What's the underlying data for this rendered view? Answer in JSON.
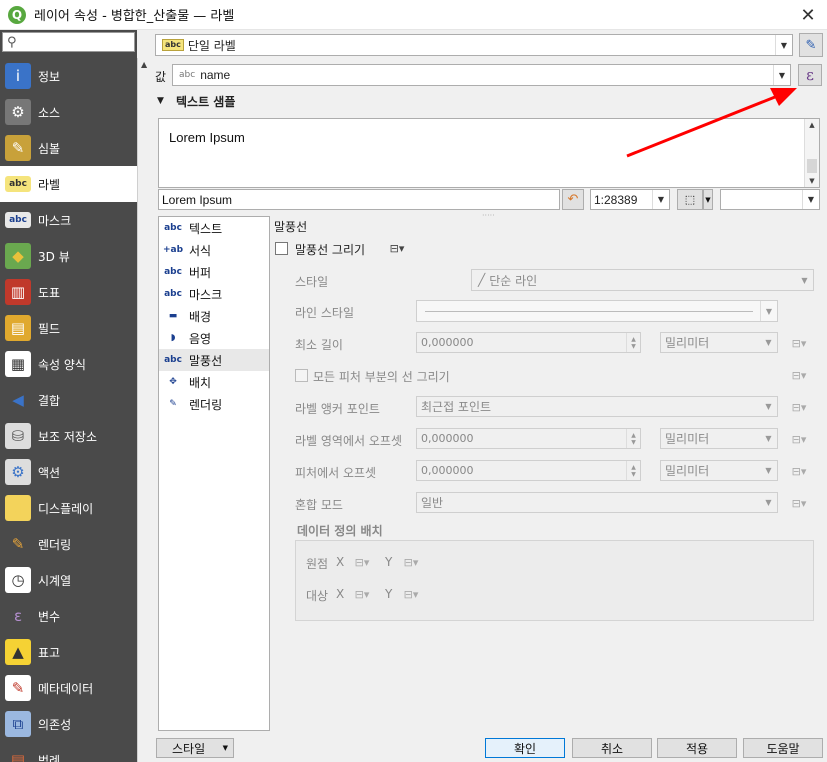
{
  "window": {
    "title": "레이어 속성 - 병합한_산출물 — 라벨",
    "close_glyph": "✕"
  },
  "sidebar": {
    "search_placeholder": "",
    "items": [
      {
        "label": "정보",
        "icon": "info-icon",
        "active": false
      },
      {
        "label": "소스",
        "icon": "source-wrench-icon",
        "active": false
      },
      {
        "label": "심볼",
        "icon": "symbology-brush-icon",
        "active": false
      },
      {
        "label": "라벨",
        "icon": "labels-abc-icon",
        "active": true
      },
      {
        "label": "마스크",
        "icon": "mask-abc-icon",
        "active": false
      },
      {
        "label": "3D 뷰",
        "icon": "3d-cube-icon",
        "active": false
      },
      {
        "label": "도표",
        "icon": "diagram-icon",
        "active": false
      },
      {
        "label": "필드",
        "icon": "fields-icon",
        "active": false
      },
      {
        "label": "속성 양식",
        "icon": "attributes-form-icon",
        "active": false
      },
      {
        "label": "결합",
        "icon": "joins-icon",
        "active": false
      },
      {
        "label": "보조 저장소",
        "icon": "auxiliary-storage-icon",
        "active": false
      },
      {
        "label": "액션",
        "icon": "actions-gear-icon",
        "active": false
      },
      {
        "label": "디스플레이",
        "icon": "display-bubble-icon",
        "active": false
      },
      {
        "label": "렌더링",
        "icon": "rendering-brush-icon",
        "active": false
      },
      {
        "label": "시계열",
        "icon": "temporal-clock-icon",
        "active": false
      },
      {
        "label": "변수",
        "icon": "variables-epsilon-icon",
        "active": false
      },
      {
        "label": "표고",
        "icon": "elevation-icon",
        "active": false
      },
      {
        "label": "메타데이터",
        "icon": "metadata-icon",
        "active": false
      },
      {
        "label": "의존성",
        "icon": "dependencies-icon",
        "active": false
      },
      {
        "label": "범례",
        "icon": "legend-icon",
        "active": false
      }
    ]
  },
  "mode": {
    "tag": "abc",
    "value": "단일 라벨"
  },
  "value_row": {
    "label": "값",
    "tag": "abc",
    "value": "name",
    "expression_glyph": "ε"
  },
  "text_sample": {
    "title": "텍스트 샘플",
    "preview_text": "Lorem Ipsum",
    "input_value": "Lorem Ipsum",
    "scale": "1:28389"
  },
  "subtabs": [
    {
      "label": "텍스트",
      "icon": "abc",
      "active": false
    },
    {
      "label": "서식",
      "icon": "+ab",
      "active": false
    },
    {
      "label": "버퍼",
      "icon": "abc",
      "active": false
    },
    {
      "label": "마스크",
      "icon": "abc",
      "active": false
    },
    {
      "label": "배경",
      "icon": "▬",
      "active": false
    },
    {
      "label": "음영",
      "icon": "◗",
      "active": false
    },
    {
      "label": "말풍선",
      "icon": "abc",
      "active": true
    },
    {
      "label": "배치",
      "icon": "✥",
      "active": false
    },
    {
      "label": "렌더링",
      "icon": "✎",
      "active": false
    }
  ],
  "callouts": {
    "section_title": "말풍선",
    "draw_label": "말풍선 그리기",
    "style_label": "스타일",
    "style_value": "단순 라인",
    "line_style_label": "라인 스타일",
    "min_length_label": "최소 길이",
    "min_length_value": "0,000000",
    "min_length_unit": "밀리미터",
    "all_parts_label": "모든 피처 부분의 선 그리기",
    "anchor_label": "라벨 앵커 포인트",
    "anchor_value": "최근접 포인트",
    "offset_label_label": "라벨 영역에서 오프셋",
    "offset_label_value": "0,000000",
    "offset_label_unit": "밀리미터",
    "offset_feature_label": "피처에서 오프셋",
    "offset_feature_value": "0,000000",
    "offset_feature_unit": "밀리미터",
    "blend_label": "혼합 모드",
    "blend_value": "일반",
    "dd_title": "데이터 정의 배치",
    "origin_label": "원점",
    "dest_label": "대상",
    "x": "X",
    "y": "Y"
  },
  "footer": {
    "style_button": "스타일",
    "ok": "확인",
    "cancel": "취소",
    "apply": "적용",
    "help": "도움말"
  },
  "colors": {
    "sidebar_bg": "#4a4a4a",
    "accent": "#0078d7",
    "annotation_arrow": "#ff0000"
  }
}
